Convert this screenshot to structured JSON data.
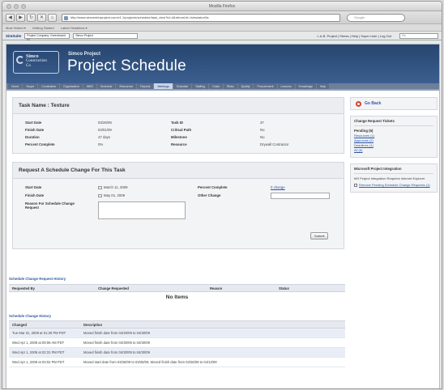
{
  "browser": {
    "window_title": "Mozilla Firefox",
    "url": "http://www.simcenterproject.com/v1.1/projects/schedule/task_view?id=4&returnUrl=/simulator/0a",
    "search_placeholder": "Google",
    "bookmarks": [
      "Most Visited ▾",
      "Getting Started",
      "Latest Headlines ▾"
    ]
  },
  "app_toolbar": {
    "brand": "SimSuite",
    "project_select": "Project Company: Greenboard v1",
    "menu_select": "Simco Project",
    "user_links": "L.A.B. Project | Stress | Help | Super User | Log Out",
    "search_placeholder": "Go"
  },
  "header": {
    "logo_line1": "Simco",
    "logo_line2": "Construction",
    "logo_line3": "Co",
    "subtitle": "Simco Project",
    "title": "Project Schedule"
  },
  "tabs": [
    "Home",
    "Scope",
    "Constraints",
    "Organization",
    "WBS",
    "Schedule",
    "Resources",
    "Reports",
    "Meetings",
    "Schedule",
    "Staffing",
    "Costs",
    "Risks",
    "Quality",
    "Procurement",
    "Lessons",
    "Knowledge",
    "Help"
  ],
  "active_tab_index": 8,
  "task": {
    "heading": "Task Name : Texture",
    "fields": [
      {
        "k": "Start Date",
        "v": "03/26/09",
        "k2": "Task ID",
        "v2": "37"
      },
      {
        "k": "Finish Date",
        "v": "04/01/09",
        "k2": "Critical Path",
        "v2": "No"
      },
      {
        "k": "Duration",
        "v": "47 days",
        "k2": "Milestone",
        "v2": "No"
      },
      {
        "k": "Percent Complete",
        "v": "0%",
        "k2": "Resource",
        "v2": "Drywall Contractor"
      }
    ]
  },
  "request": {
    "heading": "Request A Schedule Change For This Task",
    "start_label": "Start Date",
    "start_value": "March 11, 2009",
    "finish_label": "Finish Date",
    "finish_value": "May 01, 2009",
    "reason_label": "Reason For Schedule Change Request",
    "percent_label": "Percent Complete",
    "percent_value": "0 change",
    "other_label": "Other Change",
    "submit_label": "Submit"
  },
  "change_requests": {
    "title": "Schedule Change Request History",
    "columns": [
      "Requested By",
      "Change Requested",
      "Reason",
      "Status"
    ],
    "empty_text": "No Items"
  },
  "change_history": {
    "title": "Schedule Change History",
    "columns": [
      "Changed",
      "Description"
    ],
    "rows": [
      {
        "changed": "Tue Mar 31, 2009 at 01:30 PM PDT",
        "description": "Moved finish date from 04/20/09 to 04/30/09"
      },
      {
        "changed": "Wed Apr 1, 2009 at 09:06 AM PDT",
        "description": "Moved finish date from 04/30/09 to 04/30/09"
      },
      {
        "changed": "Wed Apr 1, 2009 at 02:31 PM PDT",
        "description": "Moved finish date from 04/30/09 to 04/30/09"
      },
      {
        "changed": "Wed Apr 1, 2009 at 03:02 PM PDT",
        "description": "Moved start date from 03/26/09 to 03/26/09, Moved finish date from 03/26/09 to 04/13/09"
      }
    ]
  },
  "sidebar": {
    "go_back": "Go Back",
    "cr_title": "Change Request Tickets",
    "pending_label": "Pending (6)",
    "pending_links": [
      "Resources (1)",
      "Approvals (2)",
      "Deadlines (1)",
      "All (6)"
    ],
    "msp_title": "Microsoft Project Integration",
    "msp_text": "MS Project Integration Requires Internet Explorer",
    "msp_option": "Remove Pending Schedule Change Requests (1)"
  }
}
